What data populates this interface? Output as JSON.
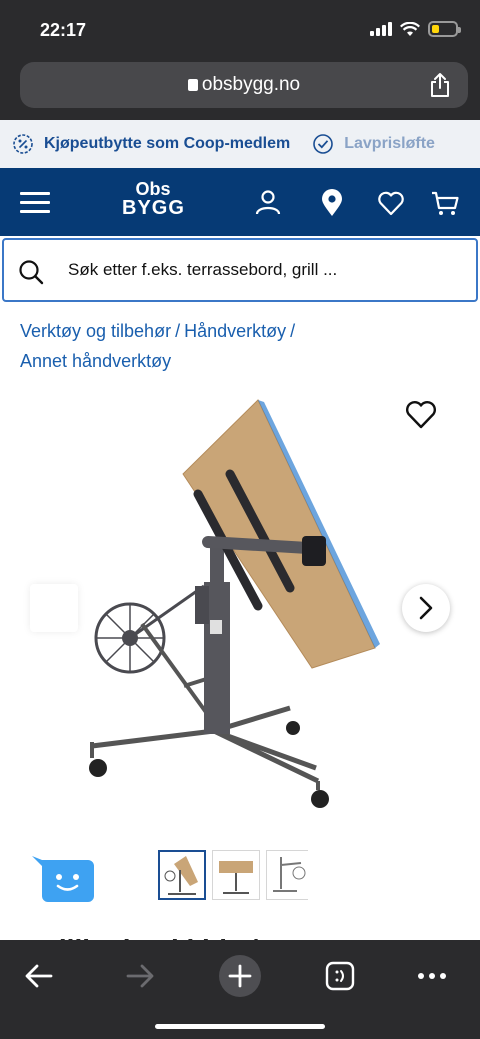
{
  "status_bar": {
    "time": "22:17",
    "battery_level": 0.3
  },
  "browser": {
    "url": "obsbygg.no"
  },
  "promo": {
    "items": [
      "Kjøpeutbytte som Coop-medlem",
      "Lavprisløfte"
    ]
  },
  "header": {
    "logo_line1": "Obs",
    "logo_line2": "BYGG"
  },
  "search": {
    "placeholder": "Søk etter f.eks. terrassebord, grill ..."
  },
  "breadcrumb": {
    "items": [
      "Verktøy og tilbehør",
      "Håndverktøy",
      "Annet håndverktøy"
    ],
    "separator": "/"
  },
  "gallery": {
    "thumbnail_count": 3,
    "active_thumbnail": 1
  },
  "product": {
    "title_partial": "Dr lilleplatel i ide /r"
  },
  "colors": {
    "brand_navy": "#063a75",
    "link_blue": "#1a5fae",
    "chat_blue": "#3ea2f2",
    "browser_dark": "#2b2b2d"
  }
}
